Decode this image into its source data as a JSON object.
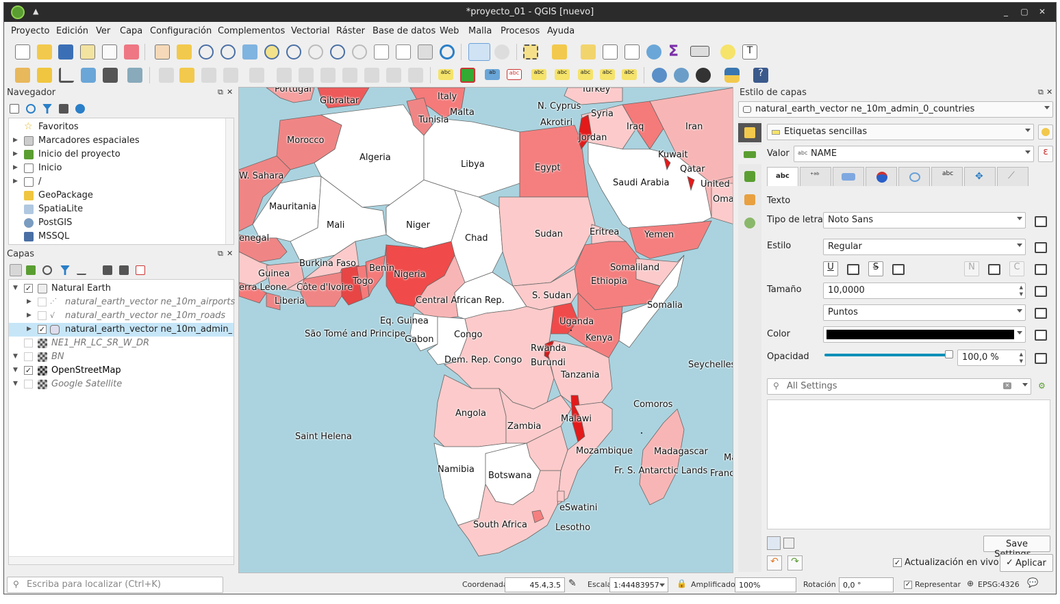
{
  "window": {
    "title": "*proyecto_01 - QGIS [nuevo]"
  },
  "menu": [
    "Proyecto",
    "Edición",
    "Ver",
    "Capa",
    "Configuración",
    "Complementos",
    "Vectorial",
    "Ráster",
    "Base de datos",
    "Web",
    "Malla",
    "Procesos",
    "Ayuda"
  ],
  "navigator": {
    "title": "Navegador",
    "items": [
      "Favoritos",
      "Marcadores espaciales",
      "Inicio del proyecto",
      "Inicio",
      "/",
      "GeoPackage",
      "SpatiaLite",
      "PostGIS",
      "MSSQL"
    ]
  },
  "layers": {
    "title": "Capas",
    "items": [
      {
        "label": "Natural Earth",
        "checked": "✓"
      },
      {
        "label": "natural_earth_vector ne_10m_airports",
        "checked": ""
      },
      {
        "label": "natural_earth_vector ne_10m_roads",
        "checked": ""
      },
      {
        "label": "natural_earth_vector ne_10m_admin_0_countries",
        "checked": "✓"
      },
      {
        "label": "NE1_HR_LC_SR_W_DR",
        "checked": ""
      },
      {
        "label": "BN",
        "checked": ""
      },
      {
        "label": "OpenStreetMap",
        "checked": "✓"
      },
      {
        "label": "Google Satellite",
        "checked": ""
      }
    ]
  },
  "locator": {
    "placeholder": "Escriba para localizar (Ctrl+K)"
  },
  "style_panel": {
    "title": "Estilo de capas",
    "layer": "natural_earth_vector ne_10m_admin_0_countries",
    "mode": "Etiquetas sencillas",
    "value_label": "Valor",
    "value": "NAME",
    "tab_text_icon": "abc",
    "section": "Texto",
    "font_label": "Tipo de letra",
    "font_value": "Noto Sans",
    "style_label": "Estilo",
    "style_value": "Regular",
    "size_label": "Tamaño",
    "size_value": "10,0000",
    "unit_value": "Puntos",
    "color_label": "Color",
    "color_value": "#000000",
    "opacity_label": "Opacidad",
    "opacity_value": "100,0 %",
    "opacity_fraction": 1.0,
    "search_placeholder": "All Settings",
    "save_button": "Save Settings...",
    "live_update": "Actualización en vivo",
    "apply_button": "Aplicar"
  },
  "status": {
    "coord_label": "Coordenada",
    "coord_value": "45.4,3.5",
    "scale_label": "Escala",
    "scale_value": "1:44483957",
    "mag_label": "Amplificador",
    "mag_value": "100%",
    "rot_label": "Rotación",
    "rot_value": "0,0 °",
    "render_label": "Representar",
    "crs": "EPSG:4326"
  },
  "map_labels": [
    {
      "t": "Portugal"
    },
    {
      "t": "Gibraltar"
    },
    {
      "t": "Italy"
    },
    {
      "t": "Turkey"
    },
    {
      "t": "Malta"
    },
    {
      "t": "N. Cyprus"
    },
    {
      "t": "Tunisia"
    },
    {
      "t": "Syria"
    },
    {
      "t": "Akrotiri"
    },
    {
      "t": "Iraq"
    },
    {
      "t": "Iran"
    },
    {
      "t": "Morocco"
    },
    {
      "t": "Jordan"
    },
    {
      "t": "Kuwait"
    },
    {
      "t": "Algeria"
    },
    {
      "t": "Libya"
    },
    {
      "t": "Egypt"
    },
    {
      "t": "Qatar"
    },
    {
      "t": "W. Sahara"
    },
    {
      "t": "Saudi Arabia"
    },
    {
      "t": "United"
    },
    {
      "t": "Oma"
    },
    {
      "t": "Mauritania"
    },
    {
      "t": "Mali"
    },
    {
      "t": "Niger"
    },
    {
      "t": "Chad"
    },
    {
      "t": "Sudan"
    },
    {
      "t": "Eritrea"
    },
    {
      "t": "Yemen"
    },
    {
      "t": "enegal"
    },
    {
      "t": "Burkina Faso"
    },
    {
      "t": "Benin"
    },
    {
      "t": "Nigeria"
    },
    {
      "t": "Somaliland"
    },
    {
      "t": "Guinea"
    },
    {
      "t": "Togo"
    },
    {
      "t": "Ethiopia"
    },
    {
      "t": "Côte d'Ivoire"
    },
    {
      "t": "erra Leone"
    },
    {
      "t": "Liberia"
    },
    {
      "t": "Central African Rep."
    },
    {
      "t": "S. Sudan"
    },
    {
      "t": "Somalia"
    },
    {
      "t": "Uganda"
    },
    {
      "t": "Eq. Guinea"
    },
    {
      "t": "São Tomé and Principe"
    },
    {
      "t": "Kenya"
    },
    {
      "t": "Gabon"
    },
    {
      "t": "Congo"
    },
    {
      "t": "Rwanda"
    },
    {
      "t": "Burundi"
    },
    {
      "t": "Seychelles"
    },
    {
      "t": "Dem. Rep. Congo"
    },
    {
      "t": "Tanzania"
    },
    {
      "t": "Comoros"
    },
    {
      "t": "Angola"
    },
    {
      "t": "Malawi"
    },
    {
      "t": "Zambia"
    },
    {
      "t": "Saint Helena"
    },
    {
      "t": "Madagascar"
    },
    {
      "t": "Mozambique"
    },
    {
      "t": "Namibia"
    },
    {
      "t": "Fr. S. Antarctic Lands"
    },
    {
      "t": "Botswana"
    },
    {
      "t": "Franc"
    },
    {
      "t": "eSwatini"
    },
    {
      "t": "South Africa"
    },
    {
      "t": "Lesotho"
    },
    {
      "t": "Ma"
    }
  ],
  "colors": {
    "sea": "#aad3df",
    "accent": "#0a8fb8",
    "selected_row": "#c6e6f8"
  }
}
